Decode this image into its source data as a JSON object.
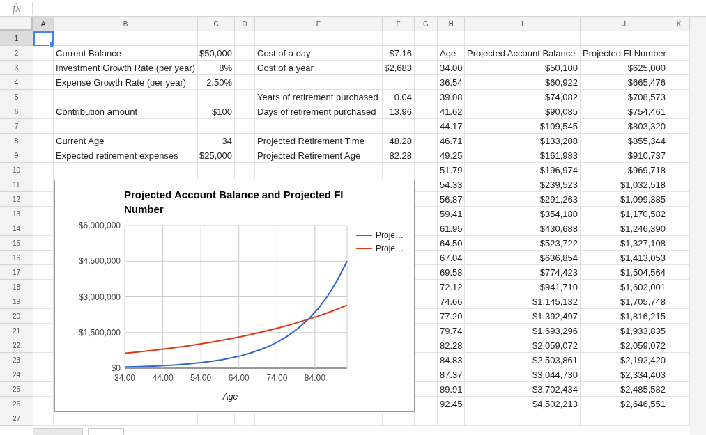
{
  "formula_bar": {
    "icon_label": "fx"
  },
  "columns": [
    {
      "label": "A",
      "selected": true
    },
    {
      "label": "B",
      "selected": false
    },
    {
      "label": "C",
      "selected": false
    },
    {
      "label": "D",
      "selected": false
    },
    {
      "label": "E",
      "selected": false
    },
    {
      "label": "F",
      "selected": false
    },
    {
      "label": "G",
      "selected": false
    },
    {
      "label": "H",
      "selected": false
    },
    {
      "label": "I",
      "selected": false
    },
    {
      "label": "J",
      "selected": false
    },
    {
      "label": "K",
      "selected": false
    }
  ],
  "rows": [
    {
      "number": "1",
      "selected": true
    },
    {
      "number": "2",
      "selected": false,
      "b": {
        "text": "Current Balance",
        "kind": "label"
      },
      "c": {
        "text": "$50,000",
        "kind": "value"
      },
      "e": {
        "text": "Cost of a day",
        "kind": "label"
      },
      "f": {
        "text": "$7.16",
        "kind": "value"
      },
      "h": {
        "text": "Age",
        "kind": "label"
      },
      "i": {
        "text": "Projected Account Balance",
        "kind": "label"
      },
      "j": {
        "text": "Projected FI Number",
        "kind": "label"
      }
    },
    {
      "number": "3",
      "selected": false,
      "b": {
        "text": "Investment Growth Rate (per year)",
        "kind": "label"
      },
      "c": {
        "text": "8%",
        "kind": "value"
      },
      "e": {
        "text": "Cost of a year",
        "kind": "label"
      },
      "f": {
        "text": "$2,683",
        "kind": "value"
      },
      "h": {
        "text": "34.00",
        "kind": "label"
      },
      "i": {
        "text": "$50,100",
        "kind": "value"
      },
      "j": {
        "text": "$625,000",
        "kind": "value"
      }
    },
    {
      "number": "4",
      "selected": false,
      "b": {
        "text": "Expense Growth Rate (per year)",
        "kind": "label"
      },
      "c": {
        "text": "2.50%",
        "kind": "value"
      },
      "h": {
        "text": "36.54",
        "kind": "label"
      },
      "i": {
        "text": "$60,922",
        "kind": "value"
      },
      "j": {
        "text": "$665,476",
        "kind": "value"
      }
    },
    {
      "number": "5",
      "selected": false,
      "e": {
        "text": "Years of retirement purchased",
        "kind": "label"
      },
      "f": {
        "text": "0.04",
        "kind": "value"
      },
      "h": {
        "text": "39.08",
        "kind": "label"
      },
      "i": {
        "text": "$74,082",
        "kind": "value"
      },
      "j": {
        "text": "$708,573",
        "kind": "value"
      }
    },
    {
      "number": "6",
      "selected": false,
      "b": {
        "text": "Contribution amount",
        "kind": "label"
      },
      "c": {
        "text": "$100",
        "kind": "value"
      },
      "e": {
        "text": "Days of retirement purchased",
        "kind": "label"
      },
      "f": {
        "text": "13.96",
        "kind": "value"
      },
      "h": {
        "text": "41.62",
        "kind": "label"
      },
      "i": {
        "text": "$90,085",
        "kind": "value"
      },
      "j": {
        "text": "$754,461",
        "kind": "value"
      }
    },
    {
      "number": "7",
      "selected": false,
      "h": {
        "text": "44.17",
        "kind": "label"
      },
      "i": {
        "text": "$109,545",
        "kind": "value"
      },
      "j": {
        "text": "$803,320",
        "kind": "value"
      }
    },
    {
      "number": "8",
      "selected": false,
      "b": {
        "text": "Current Age",
        "kind": "label"
      },
      "c": {
        "text": "34",
        "kind": "value"
      },
      "e": {
        "text": "Projected Retirement Time",
        "kind": "label"
      },
      "f": {
        "text": "48.28",
        "kind": "value"
      },
      "h": {
        "text": "46.71",
        "kind": "label"
      },
      "i": {
        "text": "$133,208",
        "kind": "value"
      },
      "j": {
        "text": "$855,344",
        "kind": "value"
      }
    },
    {
      "number": "9",
      "selected": false,
      "b": {
        "text": "Expected retirement expenses",
        "kind": "label"
      },
      "c": {
        "text": "$25,000",
        "kind": "value"
      },
      "e": {
        "text": "Projected Retirement Age",
        "kind": "label"
      },
      "f": {
        "text": "82.28",
        "kind": "value"
      },
      "h": {
        "text": "49.25",
        "kind": "label"
      },
      "i": {
        "text": "$161,983",
        "kind": "value"
      },
      "j": {
        "text": "$910,737",
        "kind": "value"
      }
    },
    {
      "number": "10",
      "selected": false,
      "h": {
        "text": "51.79",
        "kind": "label"
      },
      "i": {
        "text": "$196,974",
        "kind": "value"
      },
      "j": {
        "text": "$969,718",
        "kind": "value"
      }
    },
    {
      "number": "11",
      "selected": false,
      "h": {
        "text": "54.33",
        "kind": "label"
      },
      "i": {
        "text": "$239,523",
        "kind": "value"
      },
      "j": {
        "text": "$1,032,518",
        "kind": "value"
      }
    },
    {
      "number": "12",
      "selected": false,
      "h": {
        "text": "56.87",
        "kind": "label"
      },
      "i": {
        "text": "$291,263",
        "kind": "value"
      },
      "j": {
        "text": "$1,099,385",
        "kind": "value"
      }
    },
    {
      "number": "13",
      "selected": false,
      "h": {
        "text": "59.41",
        "kind": "label"
      },
      "i": {
        "text": "$354,180",
        "kind": "value"
      },
      "j": {
        "text": "$1,170,582",
        "kind": "value"
      }
    },
    {
      "number": "14",
      "selected": false,
      "h": {
        "text": "61.95",
        "kind": "label"
      },
      "i": {
        "text": "$430,688",
        "kind": "value"
      },
      "j": {
        "text": "$1,246,390",
        "kind": "value"
      }
    },
    {
      "number": "15",
      "selected": false,
      "h": {
        "text": "64.50",
        "kind": "label"
      },
      "i": {
        "text": "$523,722",
        "kind": "value"
      },
      "j": {
        "text": "$1,327,108",
        "kind": "value"
      }
    },
    {
      "number": "16",
      "selected": false,
      "h": {
        "text": "67.04",
        "kind": "label"
      },
      "i": {
        "text": "$636,854",
        "kind": "value"
      },
      "j": {
        "text": "$1,413,053",
        "kind": "value"
      }
    },
    {
      "number": "17",
      "selected": false,
      "h": {
        "text": "69.58",
        "kind": "label"
      },
      "i": {
        "text": "$774,423",
        "kind": "value"
      },
      "j": {
        "text": "$1,504,564",
        "kind": "value"
      }
    },
    {
      "number": "18",
      "selected": false,
      "h": {
        "text": "72.12",
        "kind": "label"
      },
      "i": {
        "text": "$941,710",
        "kind": "value"
      },
      "j": {
        "text": "$1,602,001",
        "kind": "value"
      }
    },
    {
      "number": "19",
      "selected": false,
      "h": {
        "text": "74.66",
        "kind": "label"
      },
      "i": {
        "text": "$1,145,132",
        "kind": "value"
      },
      "j": {
        "text": "$1,705,748",
        "kind": "value"
      }
    },
    {
      "number": "20",
      "selected": false,
      "h": {
        "text": "77.20",
        "kind": "label"
      },
      "i": {
        "text": "$1,392,497",
        "kind": "value"
      },
      "j": {
        "text": "$1,816,215",
        "kind": "value"
      }
    },
    {
      "number": "21",
      "selected": false,
      "h": {
        "text": "79.74",
        "kind": "label"
      },
      "i": {
        "text": "$1,693,296",
        "kind": "value"
      },
      "j": {
        "text": "$1,933,835",
        "kind": "value"
      }
    },
    {
      "number": "22",
      "selected": false,
      "h": {
        "text": "82.28",
        "kind": "label"
      },
      "i": {
        "text": "$2,059,072",
        "kind": "value"
      },
      "j": {
        "text": "$2,059,072",
        "kind": "value"
      }
    },
    {
      "number": "23",
      "selected": false,
      "h": {
        "text": "84.83",
        "kind": "label"
      },
      "i": {
        "text": "$2,503,861",
        "kind": "value"
      },
      "j": {
        "text": "$2,192,420",
        "kind": "value"
      }
    },
    {
      "number": "24",
      "selected": false,
      "h": {
        "text": "87.37",
        "kind": "label"
      },
      "i": {
        "text": "$3,044,730",
        "kind": "value"
      },
      "j": {
        "text": "$2,334,403",
        "kind": "value"
      }
    },
    {
      "number": "25",
      "selected": false,
      "h": {
        "text": "89.91",
        "kind": "label"
      },
      "i": {
        "text": "$3,702,434",
        "kind": "value"
      },
      "j": {
        "text": "$2,485,582",
        "kind": "value"
      }
    },
    {
      "number": "26",
      "selected": false,
      "h": {
        "text": "92.45",
        "kind": "label"
      },
      "i": {
        "text": "$4,502,213",
        "kind": "value"
      },
      "j": {
        "text": "$2,646,551",
        "kind": "value"
      }
    },
    {
      "number": "27",
      "selected": false
    }
  ],
  "chart": {
    "chart_data": {
      "type": "line",
      "grid": true,
      "title": "Projected Account Balance and Projected FI Number",
      "xlabel": "Age",
      "x": [
        34.0,
        36.54,
        39.08,
        41.62,
        44.17,
        46.71,
        49.25,
        51.79,
        54.33,
        56.87,
        59.41,
        61.95,
        64.5,
        67.04,
        69.58,
        72.12,
        74.66,
        77.2,
        79.74,
        82.28,
        84.83,
        87.37,
        89.91,
        92.45
      ],
      "series": [
        {
          "name": "Proje…",
          "color": "#3366cc",
          "values": [
            50100,
            60922,
            74082,
            90085,
            109545,
            133208,
            161983,
            196974,
            239523,
            291263,
            354180,
            430688,
            523722,
            636854,
            774423,
            941710,
            1145132,
            1392497,
            1693296,
            2059072,
            2503861,
            3044730,
            3702434,
            4502213
          ]
        },
        {
          "name": "Proje…",
          "color": "#dc3912",
          "values": [
            625000,
            665476,
            708573,
            754461,
            803320,
            855344,
            910737,
            969718,
            1032518,
            1099385,
            1170582,
            1246390,
            1327108,
            1413053,
            1504564,
            1602001,
            1705748,
            1816215,
            1933835,
            2059072,
            2192420,
            2334403,
            2485582,
            2646551
          ]
        }
      ],
      "xlim": [
        34,
        92.45
      ],
      "ylim": [
        0,
        6000000
      ],
      "xticks": [
        {
          "value": 34,
          "label": "34.00"
        },
        {
          "value": 44,
          "label": "44.00"
        },
        {
          "value": 54,
          "label": "54.00"
        },
        {
          "value": 64,
          "label": "64.00"
        },
        {
          "value": 74,
          "label": "74.00"
        },
        {
          "value": 84,
          "label": "84.00"
        }
      ],
      "yticks": [
        {
          "value": 0,
          "label": "$0"
        },
        {
          "value": 1500000,
          "label": "$1,500,000"
        },
        {
          "value": 3000000,
          "label": "$3,000,000"
        },
        {
          "value": 4500000,
          "label": "$4,500,000"
        },
        {
          "value": 6000000,
          "label": "$6,000,000"
        }
      ]
    }
  },
  "sheet_tabs": [
    {
      "selected": false
    },
    {
      "selected": true
    }
  ]
}
